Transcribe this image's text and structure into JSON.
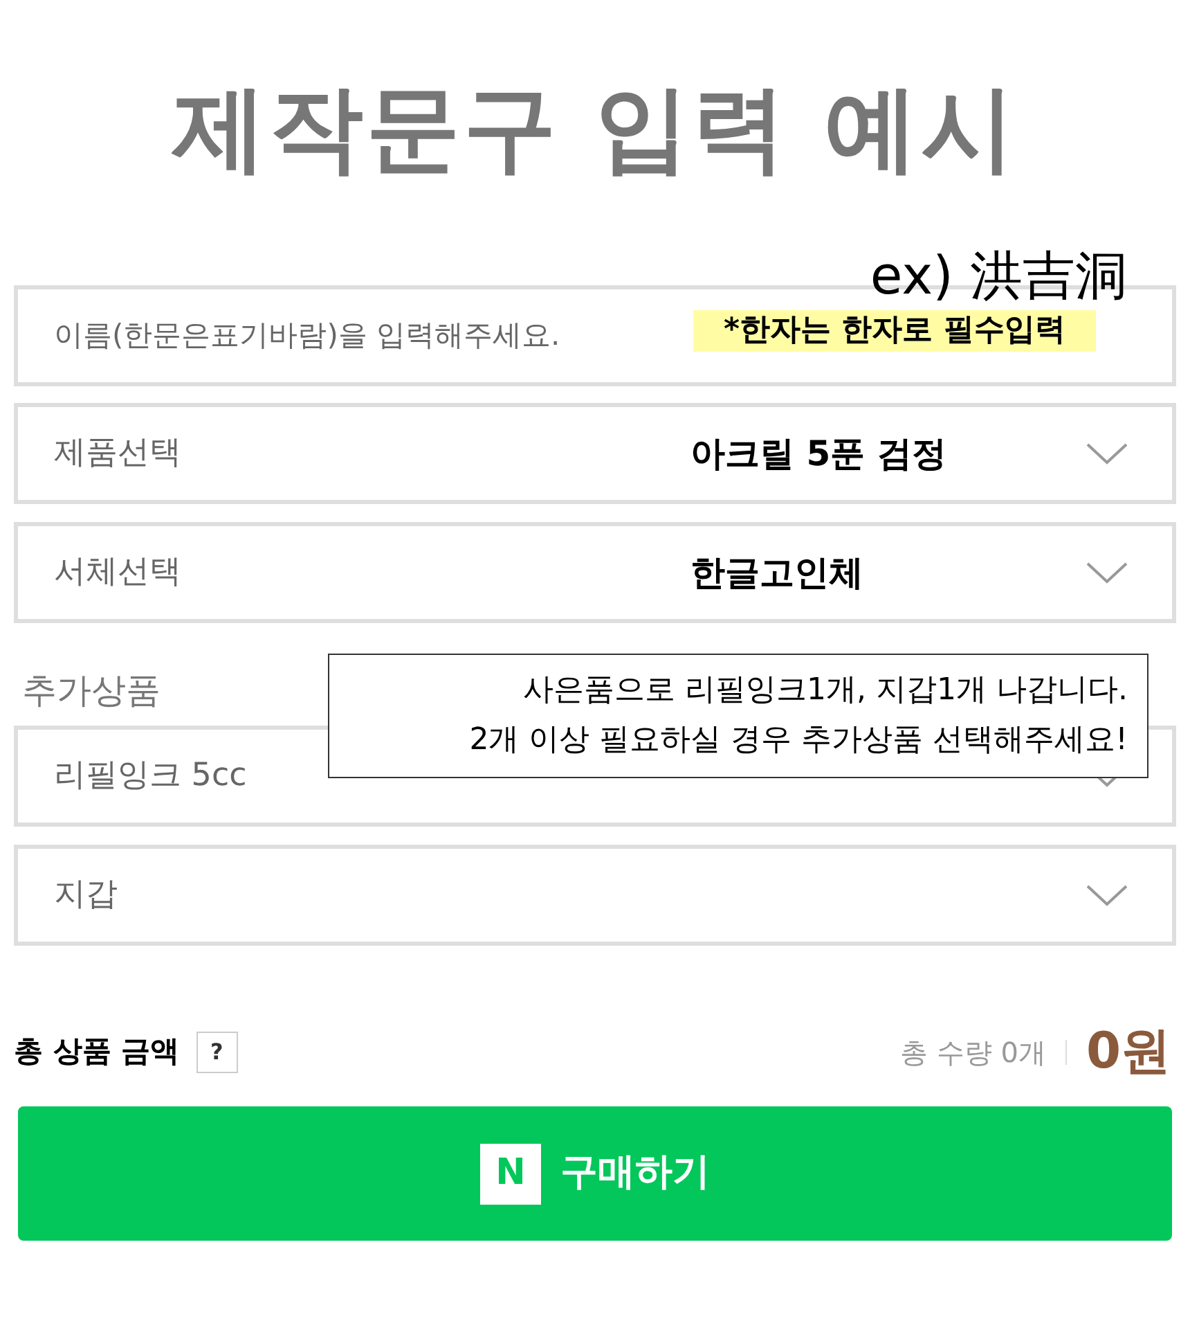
{
  "title": "제작문구 입력 예시",
  "example": "ex) 洪吉洞",
  "name_field": {
    "placeholder": "이름(한문은표기바람)을 입력해주세요.",
    "note": "*한자는 한자로 필수입력"
  },
  "selects": [
    {
      "label": "제품선택",
      "value": "아크릴 5푼 검정"
    },
    {
      "label": "서체선택",
      "value": "한글고인체"
    }
  ],
  "addons": {
    "heading": "추가상품",
    "items": [
      {
        "label": "리필잉크 5cc"
      },
      {
        "label": "지갑"
      }
    ]
  },
  "notice": [
    "사은품으로 리필잉크1개, 지갑1개 나갑니다.",
    "2개 이상 필요하실 경우 추가상품 선택해주세요!"
  ],
  "total": {
    "label": "총 상품 금액",
    "help": "?",
    "quantity": "총 수량 0개",
    "price": "0원"
  },
  "buy_button": {
    "logo": "N",
    "label": "구매하기"
  }
}
